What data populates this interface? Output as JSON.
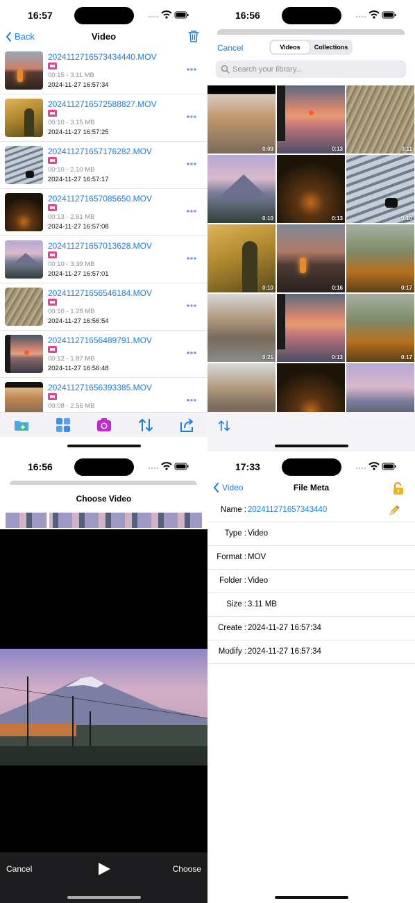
{
  "video_list": {
    "status_time": "16:57",
    "back_label": "Back",
    "title": "Video",
    "items": [
      {
        "name": "2024112716573434440.MOV",
        "meta": "00:15 - 3.11 MB",
        "date": "2024-11-27 16:57:34"
      },
      {
        "name": "2024112716572588827.MOV",
        "meta": "00:10 - 3.15 MB",
        "date": "2024-11-27 16:57:25"
      },
      {
        "name": "202411271657176282.MOV",
        "meta": "00:10 - 2.10 MB",
        "date": "2024-11-27 16:57:17"
      },
      {
        "name": "202411271657085650.MOV",
        "meta": "00:13 - 2.61 MB",
        "date": "2024-11-27 16:57:08"
      },
      {
        "name": "202411271657013628.MOV",
        "meta": "00:10 - 3.39 MB",
        "date": "2024-11-27 16:57:01"
      },
      {
        "name": "202411271656546184.MOV",
        "meta": "00:10 - 1.28 MB",
        "date": "2024-11-27 16:56:54"
      },
      {
        "name": "202411271656489791.MOV",
        "meta": "00:12 - 1.87 MB",
        "date": "2024-11-27 16:56:48"
      },
      {
        "name": "202411271656393385.MOV",
        "meta": "00:08 - 2.56 MB",
        "date": ""
      }
    ]
  },
  "picker": {
    "status_time": "16:56",
    "cancel_label": "Cancel",
    "tabs": [
      "Videos",
      "Collections"
    ],
    "search_placeholder": "Search your library...",
    "durations": [
      "0:09",
      "0:13",
      "0:11",
      "0:10",
      "0:13",
      "0:10",
      "0:10",
      "0:16",
      "0:17",
      "0:21",
      "0:13",
      "0:17",
      "",
      "",
      ""
    ]
  },
  "chooser": {
    "status_time": "16:56",
    "title": "Choose Video",
    "cancel_label": "Cancel",
    "choose_label": "Choose"
  },
  "file_meta": {
    "status_time": "17:33",
    "back_label": "Video",
    "title": "File Meta",
    "rows": [
      {
        "label": "Name :",
        "value": "202411271657343440"
      },
      {
        "label": "Type :",
        "value": "Video"
      },
      {
        "label": "Format :",
        "value": "MOV"
      },
      {
        "label": "Folder :",
        "value": "Video"
      },
      {
        "label": "Size :",
        "value": "3.11 MB"
      },
      {
        "label": "Create :",
        "value": "2024-11-27 16:57:34"
      },
      {
        "label": "Modify :",
        "value": "2024-11-27 16:57:34"
      }
    ]
  },
  "colors": {
    "accent": "#1a7fe5",
    "camera_pink": "#ee3d8f",
    "toolbar_purple": "#c02ad0"
  },
  "icons": [
    "trash-icon",
    "chevron-left-icon",
    "video-camera-icon",
    "more-dots-icon",
    "folder-add-icon",
    "grid-icon",
    "camera-icon",
    "sort-arrows-icon",
    "share-icon",
    "search-icon",
    "play-icon",
    "unlock-icon",
    "pencil-icon",
    "wifi-icon",
    "battery-icon",
    "signal-icon"
  ]
}
